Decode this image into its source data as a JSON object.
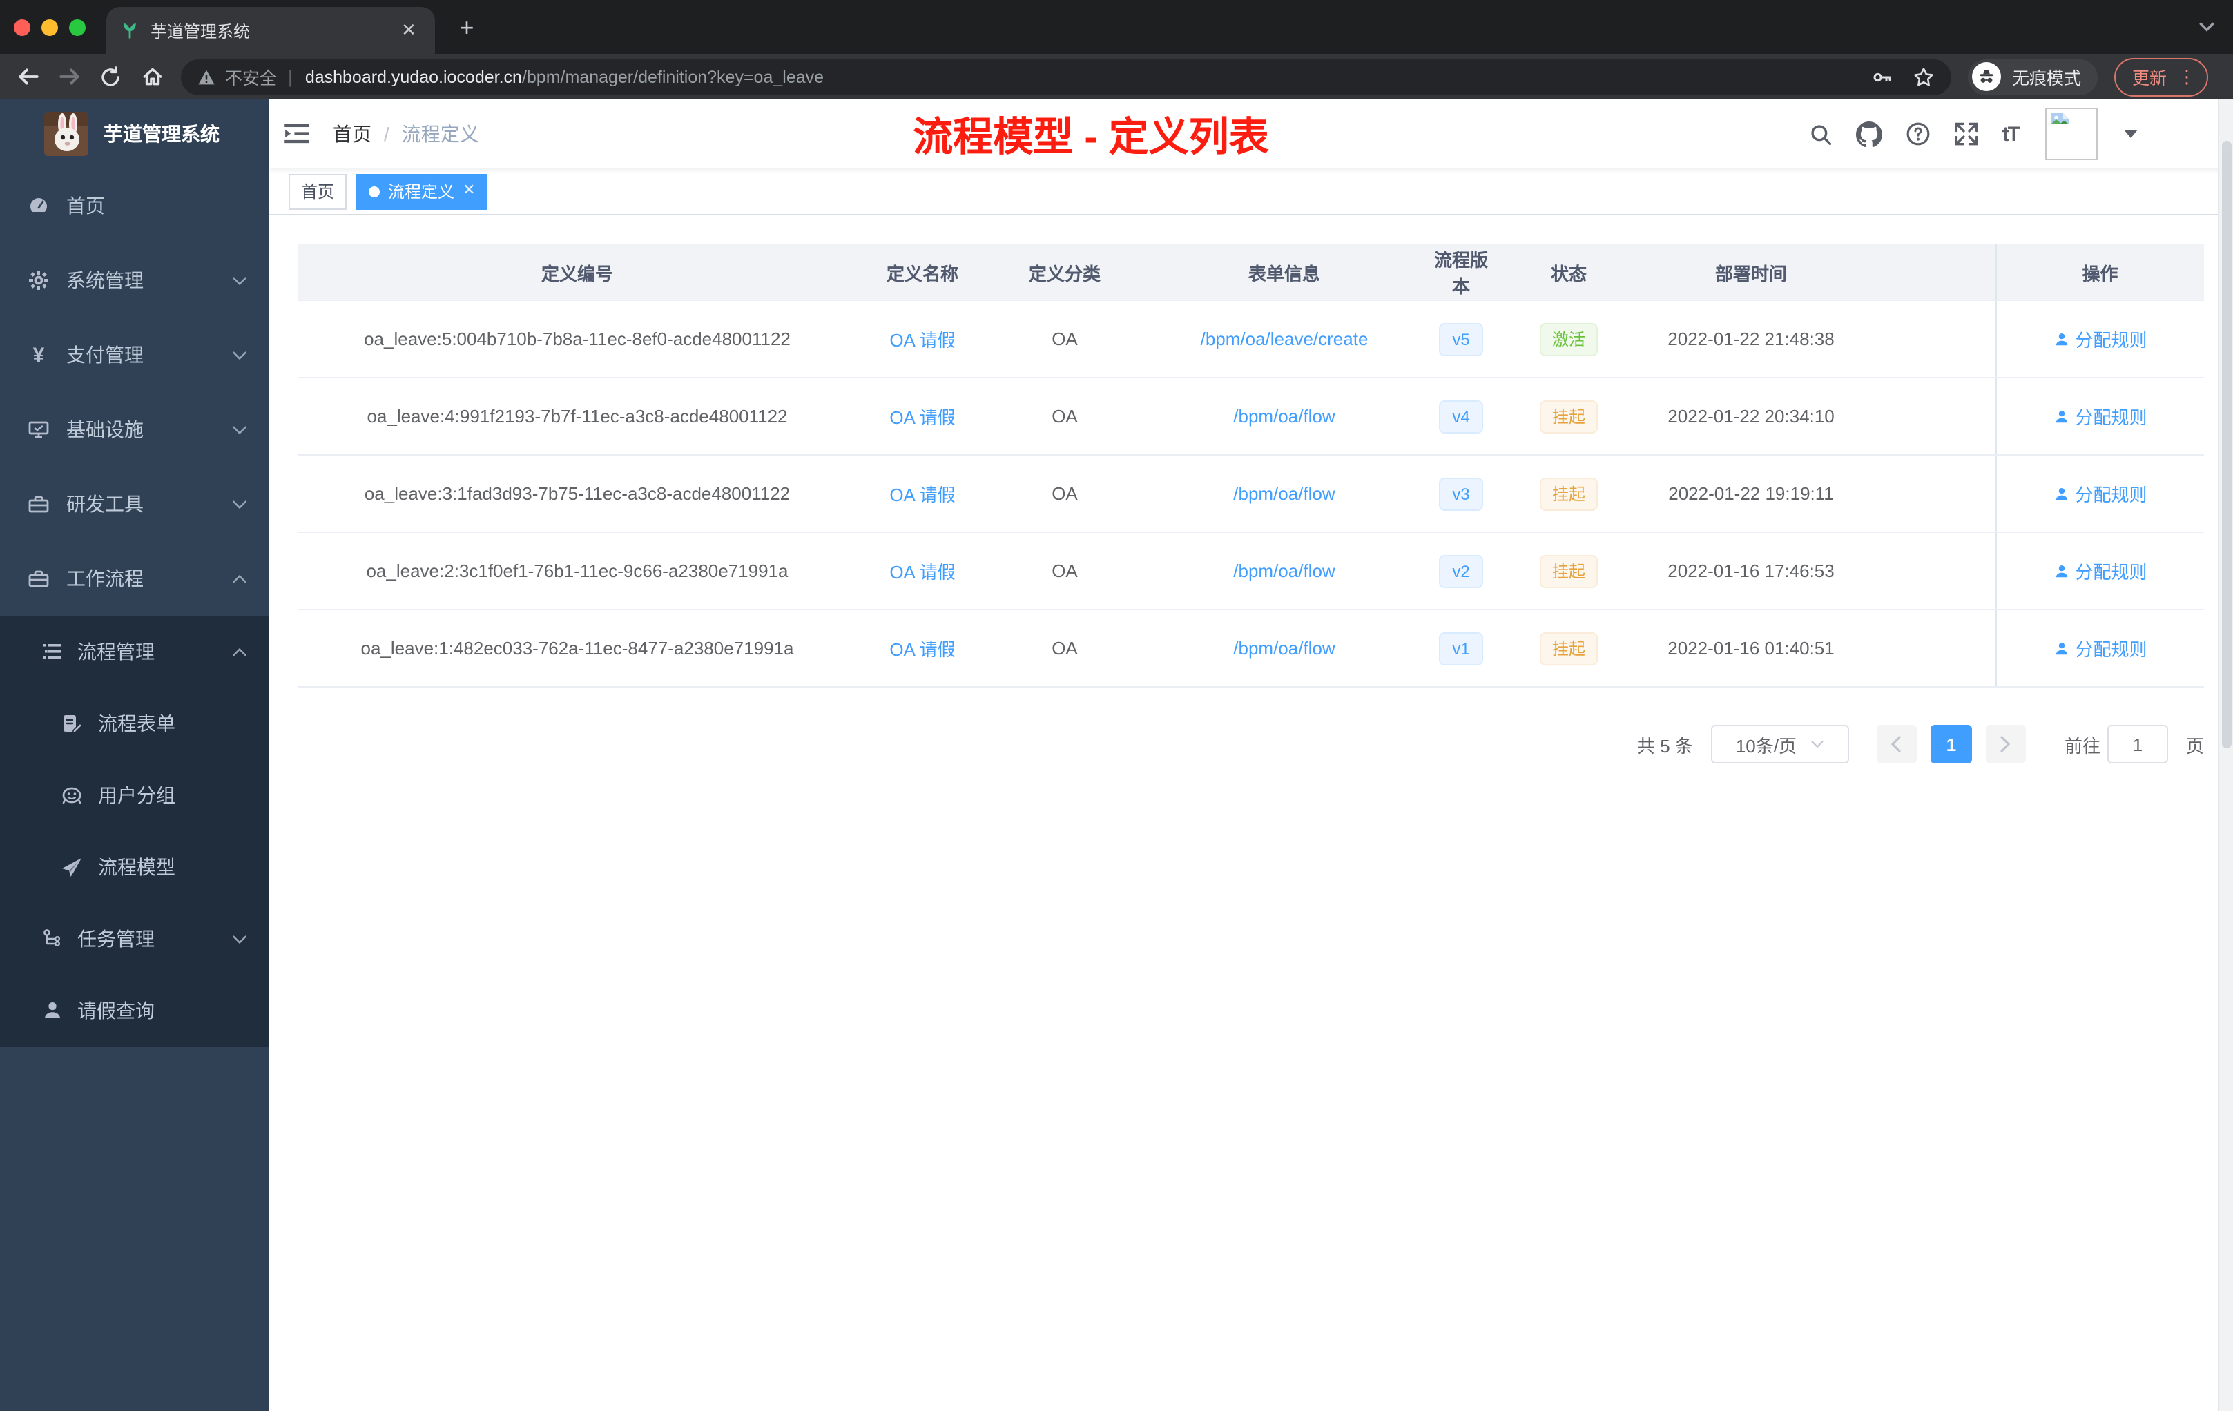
{
  "browser": {
    "tab_title": "芋道管理系统",
    "security_label": "不安全",
    "url_host": "dashboard.yudao.iocoder.cn",
    "url_path": "/bpm/manager/definition?key=oa_leave",
    "incognito_label": "无痕模式",
    "update_label": "更新"
  },
  "sidebar": {
    "app_title": "芋道管理系统",
    "items": [
      {
        "label": "首页",
        "icon": "dashboard-icon",
        "level": 1
      },
      {
        "label": "系统管理",
        "icon": "gear-icon",
        "level": 1,
        "chevron": "down"
      },
      {
        "label": "支付管理",
        "icon": "yen-icon",
        "level": 1,
        "chevron": "down"
      },
      {
        "label": "基础设施",
        "icon": "monitor-icon",
        "level": 1,
        "chevron": "down"
      },
      {
        "label": "研发工具",
        "icon": "toolbox-icon",
        "level": 1,
        "chevron": "down"
      },
      {
        "label": "工作流程",
        "icon": "toolbox-icon",
        "level": 1,
        "chevron": "up"
      },
      {
        "label": "流程管理",
        "icon": "list-icon",
        "level": 2,
        "chevron": "up"
      },
      {
        "label": "流程表单",
        "icon": "form-icon",
        "level": 3
      },
      {
        "label": "用户分组",
        "icon": "robot-icon",
        "level": 3
      },
      {
        "label": "流程模型",
        "icon": "paper-plane-icon",
        "level": 3
      },
      {
        "label": "任务管理",
        "icon": "tree-icon",
        "level": 2,
        "chevron": "down"
      },
      {
        "label": "请假查询",
        "icon": "person-icon",
        "level": 2
      }
    ]
  },
  "header": {
    "breadcrumb": {
      "home": "首页",
      "sep": "/",
      "current": "流程定义"
    },
    "annotation": "流程模型 - 定义列表",
    "font_icon": "tT"
  },
  "tags": [
    {
      "label": "首页",
      "active": false
    },
    {
      "label": "流程定义",
      "active": true
    }
  ],
  "table": {
    "columns": {
      "id": "定义编号",
      "name": "定义名称",
      "category": "定义分类",
      "form": "表单信息",
      "version": "流程版本",
      "status": "状态",
      "time": "部署时间",
      "action": "操作"
    },
    "rows": [
      {
        "id": "oa_leave:5:004b710b-7b8a-11ec-8ef0-acde48001122",
        "name": "OA 请假",
        "category": "OA",
        "form": "/bpm/oa/leave/create",
        "version": "v5",
        "status": "激活",
        "time": "2022-01-22 21:48:38",
        "action": "分配规则"
      },
      {
        "id": "oa_leave:4:991f2193-7b7f-11ec-a3c8-acde48001122",
        "name": "OA 请假",
        "category": "OA",
        "form": "/bpm/oa/flow",
        "version": "v4",
        "status": "挂起",
        "time": "2022-01-22 20:34:10",
        "action": "分配规则"
      },
      {
        "id": "oa_leave:3:1fad3d93-7b75-11ec-a3c8-acde48001122",
        "name": "OA 请假",
        "category": "OA",
        "form": "/bpm/oa/flow",
        "version": "v3",
        "status": "挂起",
        "time": "2022-01-22 19:19:11",
        "action": "分配规则"
      },
      {
        "id": "oa_leave:2:3c1f0ef1-76b1-11ec-9c66-a2380e71991a",
        "name": "OA 请假",
        "category": "OA",
        "form": "/bpm/oa/flow",
        "version": "v2",
        "status": "挂起",
        "time": "2022-01-16 17:46:53",
        "action": "分配规则"
      },
      {
        "id": "oa_leave:1:482ec033-762a-11ec-8477-a2380e71991a",
        "name": "OA 请假",
        "category": "OA",
        "form": "/bpm/oa/flow",
        "version": "v1",
        "status": "挂起",
        "time": "2022-01-16 01:40:51",
        "action": "分配规则"
      }
    ]
  },
  "pagination": {
    "total": "共 5 条",
    "page_size": "10条/页",
    "current_page": "1",
    "goto_label": "前往",
    "goto_value": "1",
    "page_unit": "页"
  },
  "colors": {
    "accent": "#409eff",
    "success": "#67c23a",
    "warning": "#e6a23c",
    "annotation_red": "#fb1d10",
    "sidebar_bg": "#304156",
    "submenu_bg": "#1f2d3d"
  }
}
